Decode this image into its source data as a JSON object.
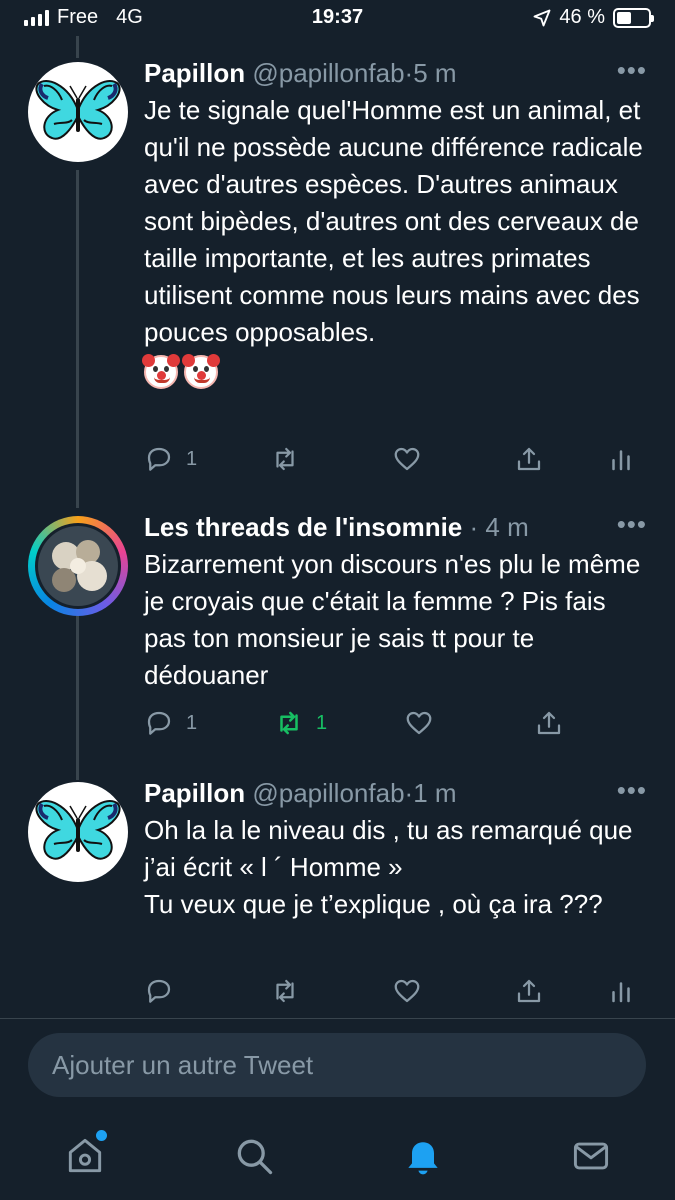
{
  "status_bar": {
    "carrier": "Free",
    "network": "4G",
    "time": "19:37",
    "battery_percent": "46 %",
    "battery_level": 0.46,
    "icons": [
      "signal-bars-icon",
      "location-arrow-icon",
      "battery-icon"
    ]
  },
  "tweets": [
    {
      "name": "Papillon",
      "handle": "@papillonfab",
      "time": "5 m",
      "text": "Je te signale quel'Homme est un animal, et qu'il ne possède aucune différence radicale avec d'autres espèces. D'autres animaux sont bipèdes, d'autres ont des cerveaux de taille importante, et les autres primates utilisent comme nous leurs mains avec des pouces opposables.",
      "emojis": [
        "clown-face-emoji",
        "clown-face-emoji"
      ],
      "reply_count": "1",
      "retweet_count": "",
      "avatar": "butterfly-avatar"
    },
    {
      "name": "Les threads de l'insomnie",
      "handle": "",
      "time": "4 m",
      "text": "Bizarrement yon discours n'es plu le même je croyais que c'était la femme ? Pis fais pas ton monsieur je sais tt pour te dédouaner",
      "reply_count": "1",
      "retweet_count": "1",
      "retweeted": true,
      "avatar": "cloudy-sky-avatar"
    },
    {
      "name": "Papillon",
      "handle": "@papillonfab",
      "time": "1 m",
      "text": "Oh la la le niveau dis , tu as remarqué que j’ai écrit «  l ´ Homme »\nTu veux que je t’explique , où ça ira ???",
      "reply_count": "",
      "retweet_count": "",
      "avatar": "butterfly-avatar"
    }
  ],
  "compose": {
    "placeholder": "Ajouter un autre Tweet"
  },
  "tab_bar": {
    "tabs": [
      "home-icon",
      "search-icon",
      "notifications-bell-icon",
      "messages-envelope-icon"
    ],
    "active": "notifications-bell-icon"
  },
  "colors": {
    "background": "#15202b",
    "secondary_text": "#8899a6",
    "accent": "#1da1f2",
    "retweet_active": "#17bf63"
  }
}
